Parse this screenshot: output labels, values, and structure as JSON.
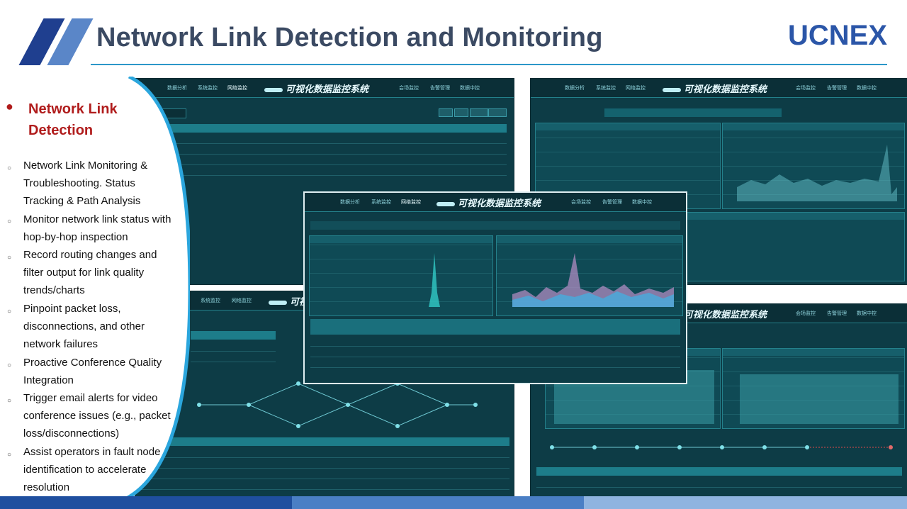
{
  "header": {
    "title": "Network Link Detection and Monitoring",
    "logo": "UCNEX",
    "accent": "#2b56a8",
    "title_color": "#3b4a63"
  },
  "content": {
    "heading": "Network Link Detection",
    "bullet_color": "#b01c1c",
    "items": [
      "Network Link Monitoring & Troubleshooting. Status Tracking & Path Analysis",
      "Monitor network link status with hop-by-hop inspection",
      "Record routing changes and filter output for link quality trends/charts",
      "Pinpoint packet loss, disconnections, and other network failures",
      "Proactive Conference Quality Integration",
      "Trigger email alerts for video conference issues (e.g., packet loss/disconnections)",
      "Assist operators in fault node identification to accelerate resolution"
    ]
  },
  "dashboard": {
    "system_title": "可视化数据监控系统",
    "nav_left": [
      "数据分析",
      "系统监控",
      "网络监控"
    ],
    "nav_right": [
      "会场监控",
      "告警管理",
      "数据中控"
    ],
    "panel_bg": "#0d3c46",
    "accent": "#34c3c9"
  }
}
